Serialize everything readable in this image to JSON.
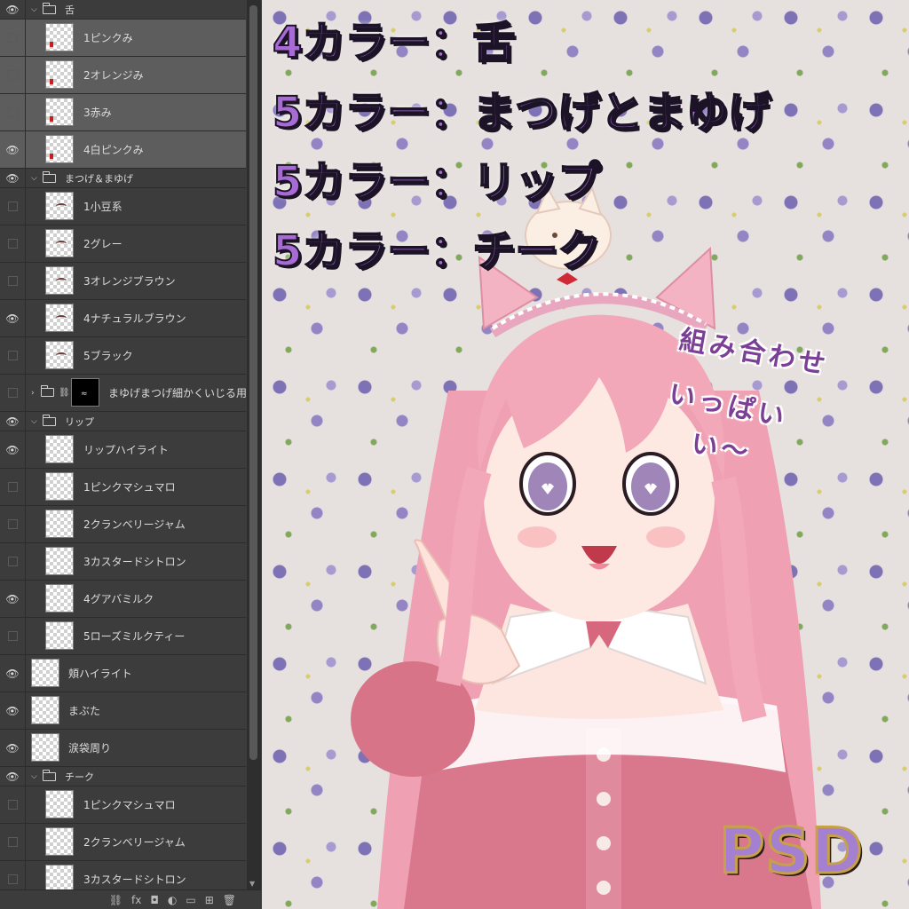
{
  "layers_panel": {
    "rows": [
      {
        "kind": "group",
        "visible": true,
        "label": "舌"
      },
      {
        "kind": "layer",
        "visible": false,
        "label": "1ピンクみ",
        "selected": true,
        "mark": "red"
      },
      {
        "kind": "layer",
        "visible": false,
        "label": "2オレンジみ",
        "selected": true,
        "mark": "red"
      },
      {
        "kind": "layer",
        "visible": false,
        "label": "3赤み",
        "selected": true,
        "mark": "red"
      },
      {
        "kind": "layer",
        "visible": true,
        "label": "4白ピンクみ",
        "selected": true,
        "mark": "red"
      },
      {
        "kind": "group",
        "visible": true,
        "label": "まつげ＆まゆげ"
      },
      {
        "kind": "layer",
        "visible": false,
        "label": "1小豆系",
        "mark": "lash"
      },
      {
        "kind": "layer",
        "visible": false,
        "label": "2グレー",
        "mark": "lash"
      },
      {
        "kind": "layer",
        "visible": false,
        "label": "3オレンジブラウン",
        "mark": "lash"
      },
      {
        "kind": "layer",
        "visible": true,
        "label": "4ナチュラルブラウン",
        "mark": "lash"
      },
      {
        "kind": "layer",
        "visible": false,
        "label": "5ブラック",
        "mark": "lash"
      },
      {
        "kind": "smart",
        "visible": false,
        "label": "まゆげまつげ細かくいじる用"
      },
      {
        "kind": "group",
        "visible": true,
        "label": "リップ"
      },
      {
        "kind": "layer",
        "visible": true,
        "label": "リップハイライト"
      },
      {
        "kind": "layer",
        "visible": false,
        "label": "1ピンクマシュマロ"
      },
      {
        "kind": "layer",
        "visible": false,
        "label": "2クランベリージャム"
      },
      {
        "kind": "layer",
        "visible": false,
        "label": "3カスタードシトロン"
      },
      {
        "kind": "layer",
        "visible": true,
        "label": "4グアバミルク"
      },
      {
        "kind": "layer",
        "visible": false,
        "label": "5ローズミルクティー"
      },
      {
        "kind": "top",
        "visible": true,
        "label": "頬ハイライト"
      },
      {
        "kind": "top",
        "visible": true,
        "label": "まぶた"
      },
      {
        "kind": "top",
        "visible": true,
        "label": "涙袋周り"
      },
      {
        "kind": "group",
        "visible": true,
        "label": "チーク"
      },
      {
        "kind": "layer",
        "visible": false,
        "label": "1ピンクマシュマロ"
      },
      {
        "kind": "layer",
        "visible": false,
        "label": "2クランベリージャム"
      },
      {
        "kind": "layer",
        "visible": false,
        "label": "3カスタードシトロン"
      }
    ],
    "footer_icons": [
      "link-icon",
      "fx-icon",
      "mask-icon",
      "adjustment-icon",
      "folder-icon",
      "new-layer-icon",
      "trash-icon"
    ],
    "footer_glyphs": [
      "⛓",
      "fx",
      "◘",
      "◐",
      "▭",
      "⊞",
      "🗑"
    ],
    "eye_glyph": "👁"
  },
  "artwork": {
    "headlines": [
      "4カラー：舌",
      "5カラー：まつげとまゆげ",
      "5カラー：リップ",
      "5カラー：チーク"
    ],
    "callout": [
      "組み合わせ",
      "いっぱい",
      "い〜"
    ],
    "badge": "PSD",
    "colors": {
      "headline_fill": "#a86bd6",
      "badge_fill": "#a57fd0",
      "badge_outline": "#c7a04b",
      "hair": "#f2a5b8",
      "dress": "#d9788c",
      "background": "#e6e1df",
      "flower": "#6d5fb0"
    }
  }
}
